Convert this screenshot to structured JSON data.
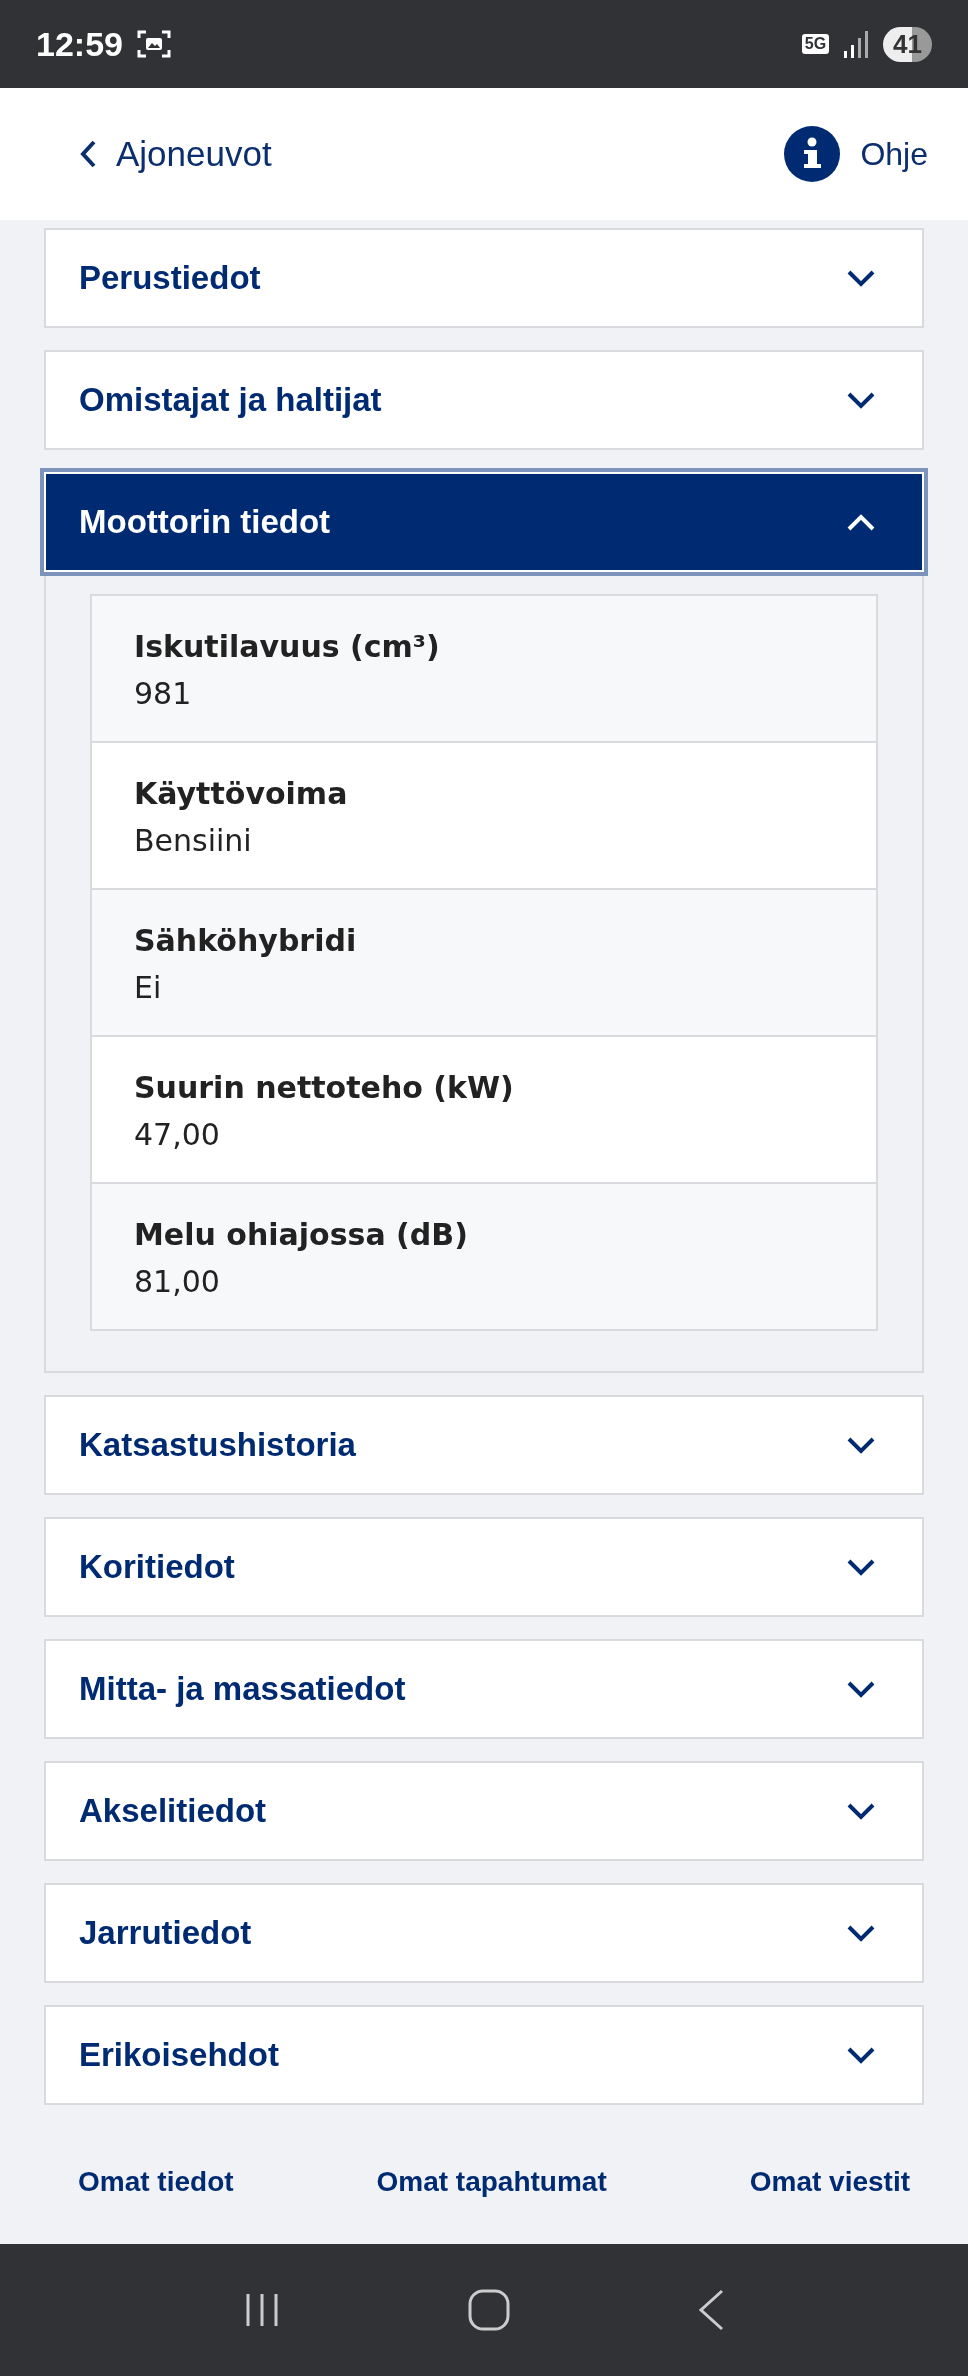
{
  "status_bar": {
    "time": "12:59",
    "network": "5G",
    "battery": "41"
  },
  "header": {
    "back_label": "Ajoneuvot",
    "help_label": "Ohje"
  },
  "sections": [
    {
      "title": "Perustiedot",
      "expanded": false
    },
    {
      "title": "Omistajat ja haltijat",
      "expanded": false
    },
    {
      "title": "Moottorin tiedot",
      "expanded": true,
      "fields": [
        {
          "label": "Iskutilavuus (cm³)",
          "value": "981"
        },
        {
          "label": "Käyttövoima",
          "value": "Bensiini"
        },
        {
          "label": "Sähköhybridi",
          "value": "Ei"
        },
        {
          "label": "Suurin nettoteho (kW)",
          "value": "47,00"
        },
        {
          "label": "Melu ohiajossa (dB)",
          "value": "81,00"
        }
      ]
    },
    {
      "title": "Katsastushistoria",
      "expanded": false
    },
    {
      "title": "Koritiedot",
      "expanded": false
    },
    {
      "title": "Mitta- ja massatiedot",
      "expanded": false
    },
    {
      "title": "Akselitiedot",
      "expanded": false
    },
    {
      "title": "Jarrutiedot",
      "expanded": false
    },
    {
      "title": "Erikoisehdot",
      "expanded": false
    }
  ],
  "bottom_nav": [
    {
      "label": "Omat tiedot"
    },
    {
      "label": "Omat tapahtumat"
    },
    {
      "label": "Omat viestit"
    }
  ]
}
